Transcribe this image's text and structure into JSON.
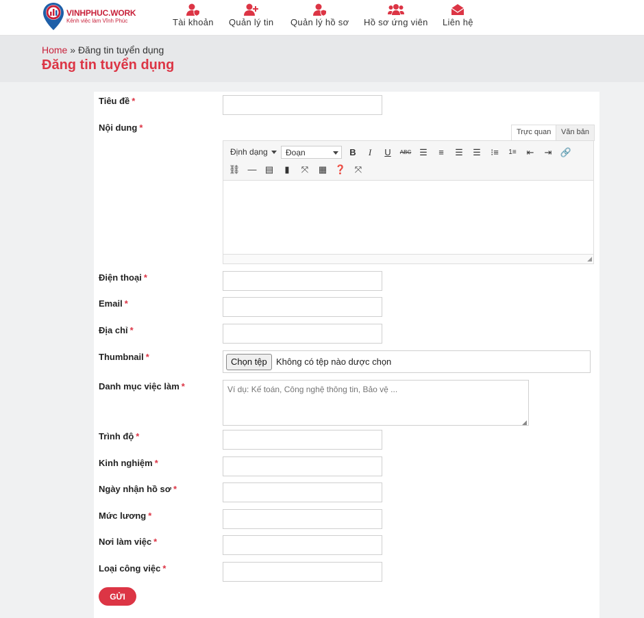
{
  "brand": {
    "name": "VINHPHUC.WORK",
    "tagline": "Kênh việc làm Vĩnh Phúc",
    "color": "#dc3545"
  },
  "nav": [
    {
      "label": "Tài khoản",
      "icon": "user-shield-icon"
    },
    {
      "label": "Quản lý tin",
      "icon": "user-plus-icon"
    },
    {
      "label": "Quản lý hồ sơ",
      "icon": "user-shield-icon"
    },
    {
      "label": "Hồ sơ ứng viên",
      "icon": "users-icon"
    },
    {
      "label": "Liên hệ",
      "icon": "envelope-open-icon"
    }
  ],
  "breadcrumb": {
    "home": "Home",
    "separator": "»",
    "current": "Đăng tin tuyển dụng"
  },
  "page_title": "Đăng tin tuyển dụng",
  "form": {
    "title_label": "Tiêu đề",
    "content_label": "Nội dung",
    "phone_label": "Điện thoại",
    "email_label": "Email",
    "address_label": "Địa chỉ",
    "thumbnail_label": "Thumbnail",
    "category_label": "Danh mục việc làm",
    "category_placeholder": "Ví dụ: Kế toán, Công nghệ thông tin, Bảo vệ ...",
    "level_label": "Trình độ",
    "experience_label": "Kinh nghiệm",
    "deadline_label": "Ngày nhận hồ sơ",
    "salary_label": "Mức lương",
    "location_label": "Nơi làm việc",
    "jobtype_label": "Loại công việc",
    "required_mark": "*",
    "submit_label": "GỬI"
  },
  "editor": {
    "tab_visual": "Trực quan",
    "tab_text": "Văn bản",
    "format_label": "Định dạng",
    "paragraph_label": "Đoạn"
  },
  "file": {
    "button": "Chọn tệp",
    "status": "Không có tệp nào dược chọn"
  }
}
